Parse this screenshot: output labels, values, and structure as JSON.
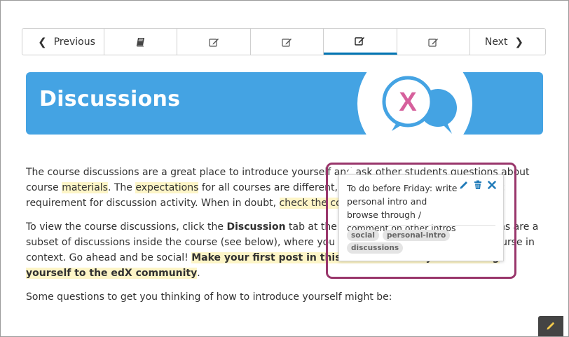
{
  "nav": {
    "previous_label": "Previous",
    "next_label": "Next",
    "units": [
      {
        "icon": "book-icon",
        "active": false
      },
      {
        "icon": "edit-icon",
        "active": false
      },
      {
        "icon": "edit-icon",
        "active": false
      },
      {
        "icon": "edit-icon",
        "active": true
      },
      {
        "icon": "edit-icon",
        "active": false
      }
    ]
  },
  "banner": {
    "title": "Discussions",
    "logo_letter": "X",
    "color": "#44a3e3"
  },
  "content": {
    "p1": [
      "The course discussions are a great place to introduce yourself and ask other students questions about course ",
      "materials",
      ". The ",
      "expectations",
      " for all courses are different, but some courses have a specific requirement for discussion activity. When in doubt, ",
      "check the course syllabus for guidance",
      "."
    ],
    "p2": [
      "To view the course discussions, click the ",
      "Discussion",
      " tab at the top of the page. These discussions are a subset of discussions inside the course (see below), where you can interact with others in the course in context. Go ahead and be social! ",
      "Make your first post in this demo course by introducing yourself to the edX community",
      "."
    ],
    "p3": "Some questions to get you thinking of how to introduce yourself might be:"
  },
  "annotation": {
    "text": "To do before Friday: write personal intro and browse through / comment on other intros",
    "tags": [
      "social",
      "personal-intro",
      "discussions"
    ],
    "frame_color": "#99366b",
    "highlight_color": "#fdf5c7"
  }
}
